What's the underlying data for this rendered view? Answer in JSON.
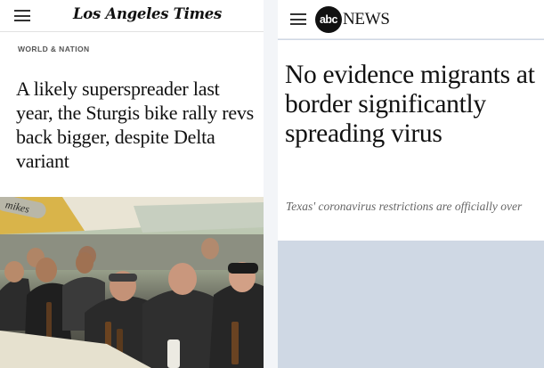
{
  "left_article": {
    "publication": "Los Angeles Times",
    "section": "WORLD & NATION",
    "headline": "A likely superspreader last year, the Sturgis bike rally revs back bigger, despite Delta variant",
    "photo_sign_text": "mikes"
  },
  "right_article": {
    "logo_mark": "abc",
    "logo_word": "NEWS",
    "headline": "No evidence migrants at border significantly spreading virus",
    "subheadline": "Texas' coronavirus restrictions are officially over"
  },
  "colors": {
    "page_background": "#ffffff",
    "right_panel_background": "#cfd8e4",
    "headline_text": "#111111",
    "subheadline_text": "#666666",
    "section_label_text": "#555555"
  },
  "icons": [
    "hamburger-menu-icon",
    "hamburger-menu-icon"
  ]
}
